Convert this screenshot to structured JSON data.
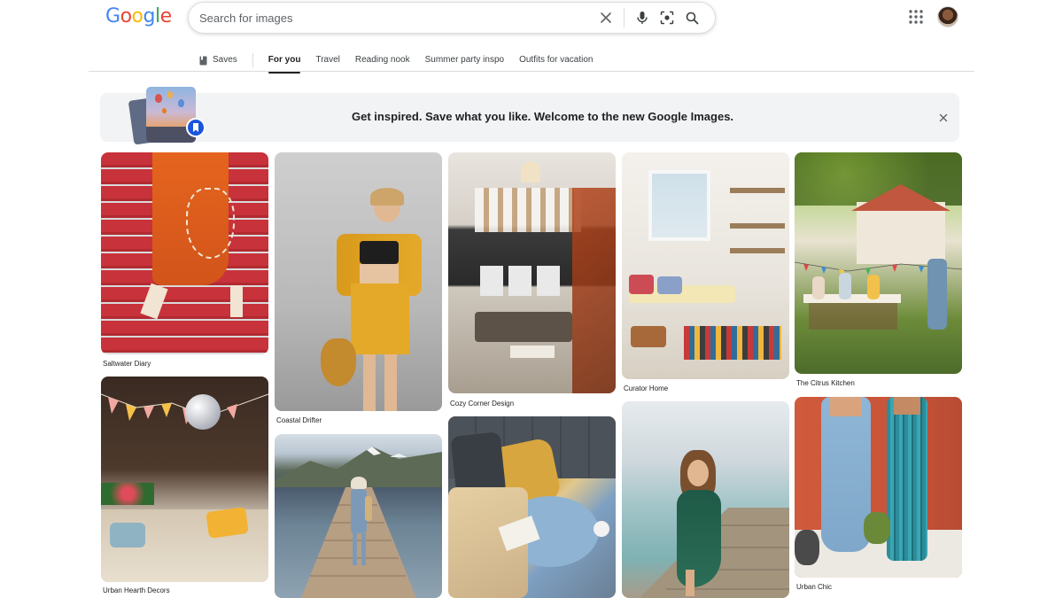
{
  "header": {
    "logo_letters": [
      {
        "ch": "G",
        "color": "#4285F4"
      },
      {
        "ch": "o",
        "color": "#EA4335"
      },
      {
        "ch": "o",
        "color": "#FBBC05"
      },
      {
        "ch": "g",
        "color": "#4285F4"
      },
      {
        "ch": "l",
        "color": "#34A853"
      },
      {
        "ch": "e",
        "color": "#EA4335"
      }
    ],
    "search": {
      "value": "",
      "placeholder": "Search for images",
      "icons": [
        "clear-icon",
        "microphone-icon",
        "lens-icon",
        "search-icon"
      ]
    },
    "apps_icon": "apps-grid-icon",
    "avatar_icon": "account-avatar"
  },
  "tabs": {
    "saves": "Saves",
    "items": [
      "For you",
      "Travel",
      "Reading nook",
      "Summer party inspo",
      "Outfits for vacation"
    ],
    "active": "For you"
  },
  "banner": {
    "text": "Get inspired. Save what you like. Welcome to the new Google Images.",
    "close_icon": "close-icon"
  },
  "grid": [
    {
      "caption": "Saltwater Diary",
      "art": "red"
    },
    {
      "caption": "Coastal Drifter",
      "art": "yellow"
    },
    {
      "caption": "Cozy Corner Design",
      "art": "loft"
    },
    {
      "caption": "Curator Home",
      "art": "room"
    },
    {
      "caption": "The Citrus Kitchen",
      "art": "garden"
    },
    {
      "caption": "Urban Hearth Decors",
      "art": "party"
    },
    {
      "caption": "",
      "art": "lake"
    },
    {
      "caption": "",
      "art": "chair"
    },
    {
      "caption": "",
      "art": "pier"
    },
    {
      "caption": "Urban Chic",
      "art": "urban"
    }
  ],
  "colors": {
    "accent": "#1a73e8",
    "banner_bg": "#f1f3f4",
    "divider": "#dadce0"
  }
}
